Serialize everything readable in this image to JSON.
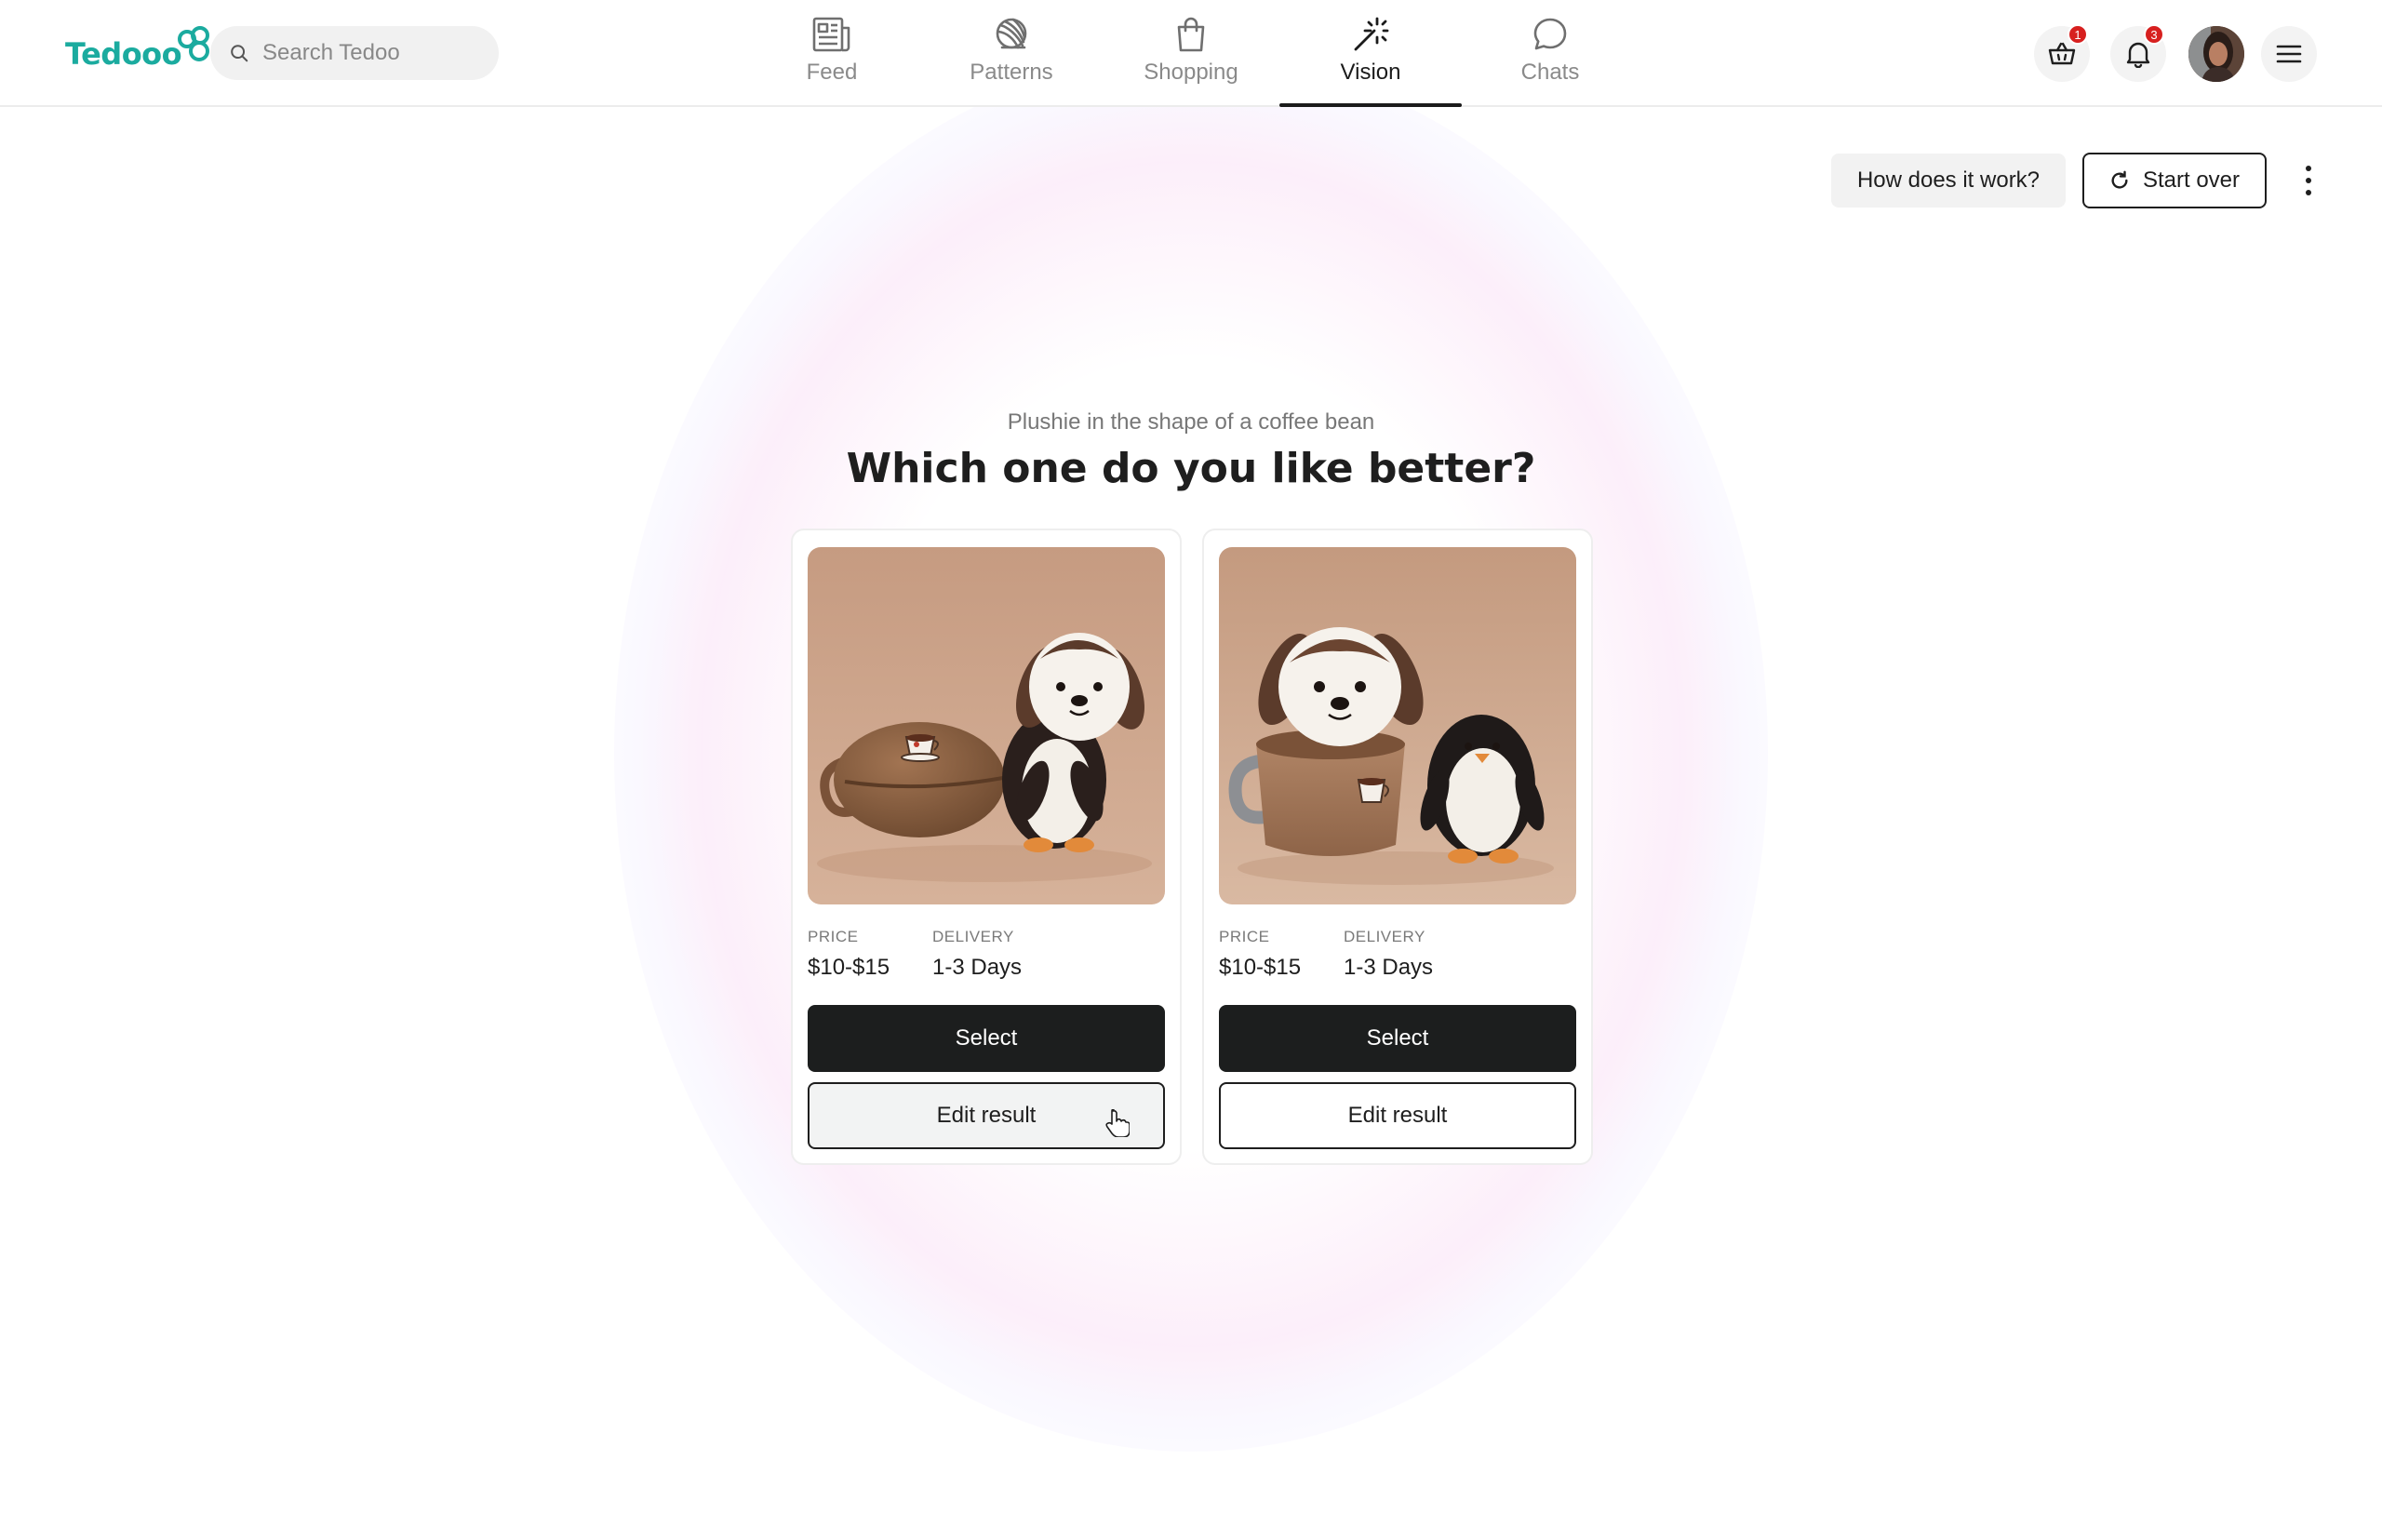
{
  "brand": {
    "name": "Tedooo",
    "accent": "#1bab9f"
  },
  "search": {
    "placeholder": "Search Tedoo",
    "icon": "search-icon"
  },
  "nav": {
    "tabs": [
      {
        "label": "Feed",
        "icon": "newspaper-icon"
      },
      {
        "label": "Patterns",
        "icon": "yarn-ball-icon"
      },
      {
        "label": "Shopping",
        "icon": "shopping-bag-icon"
      },
      {
        "label": "Vision",
        "icon": "magic-wand-icon",
        "active": true
      },
      {
        "label": "Chats",
        "icon": "chat-bubble-icon"
      }
    ]
  },
  "header_actions": {
    "basket_badge": "1",
    "notifications_badge": "3",
    "badge_color": "#d7201f"
  },
  "toolbar": {
    "how_label": "How does it work?",
    "start_over_label": "Start over"
  },
  "prompt": {
    "subtitle": "Plushie in the shape of a coffee bean",
    "title": "Which one do you like better?"
  },
  "results": [
    {
      "price_label": "PRICE",
      "price": "$10-$15",
      "delivery_label": "DELIVERY",
      "delivery": "1-3 Days",
      "select_label": "Select",
      "edit_label": "Edit result"
    },
    {
      "price_label": "PRICE",
      "price": "$10-$15",
      "delivery_label": "DELIVERY",
      "delivery": "1-3 Days",
      "select_label": "Select",
      "edit_label": "Edit result"
    }
  ]
}
